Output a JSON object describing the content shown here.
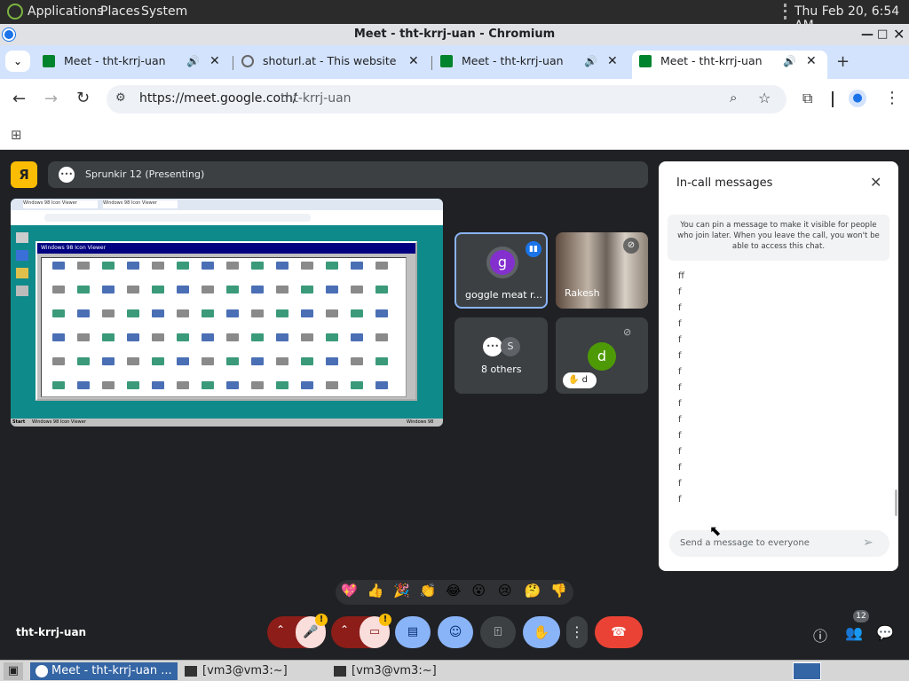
{
  "panel": {
    "applications": "Applications",
    "places": "Places",
    "system": "System",
    "clock": "Thu Feb 20,  6:54 AM"
  },
  "window": {
    "title": "Meet - tht-krrj-uan - Chromium"
  },
  "tabs": [
    {
      "title": "Meet - tht-krrj-uan",
      "icon": "meet-icon"
    },
    {
      "title": "shoturl.at - This website is",
      "icon": "globe-icon"
    },
    {
      "title": "Meet - tht-krrj-uan",
      "icon": "meet-icon"
    },
    {
      "title": "Meet - tht-krrj-uan",
      "icon": "meet-icon"
    }
  ],
  "omnibox": {
    "url_prefix": "https://meet.google.com/",
    "url_path": "tht-krrj-uan"
  },
  "meet": {
    "presenter_avatar": "Я",
    "presenting_label": "Sprunkir 12 (Presenting)",
    "meeting_code": "tht-krrj-uan",
    "participants_count": "12",
    "tiles": [
      {
        "initial": "g",
        "name": "goggle meat r...",
        "accent": "#8430ce"
      },
      {
        "name": "Rakesh"
      },
      {
        "others_initial": "S",
        "label": "8 others"
      },
      {
        "initial": "d",
        "label": "d",
        "accent": "#4e9a06"
      }
    ],
    "share": {
      "window_title": "Windows 98 Icon Viewer",
      "tab1": "Windows 98 Icon Viewer",
      "tab2": "Windows 98 Icon Viewer",
      "start": "Start",
      "taskbar_item": "Windows 98 Icon Viewer",
      "tray": "Windows 98"
    },
    "reactions": [
      "💖",
      "👍",
      "🎉",
      "👏",
      "😂",
      "😮",
      "😢",
      "🤔",
      "👎"
    ]
  },
  "chat": {
    "title": "In-call messages",
    "info": "You can pin a message to make it visible for people who join later. When you leave the call, you won't be able to access this chat.",
    "messages": [
      "ff",
      "f",
      "f",
      "f",
      "f",
      "f",
      "f",
      "f",
      "f",
      "f",
      "f",
      "f",
      "f",
      "f",
      "f"
    ],
    "placeholder": "Send a message to everyone"
  },
  "taskbar": {
    "items": [
      "Meet - tht-krrj-uan ...",
      "[vm3@vm3:~]",
      "[vm3@vm3:~]"
    ]
  },
  "colors": {
    "end_call": "#ea4335",
    "muted": "#8c1d18",
    "accent_blue": "#8ab4f8",
    "active_tile_border": "#8ab4f8"
  }
}
